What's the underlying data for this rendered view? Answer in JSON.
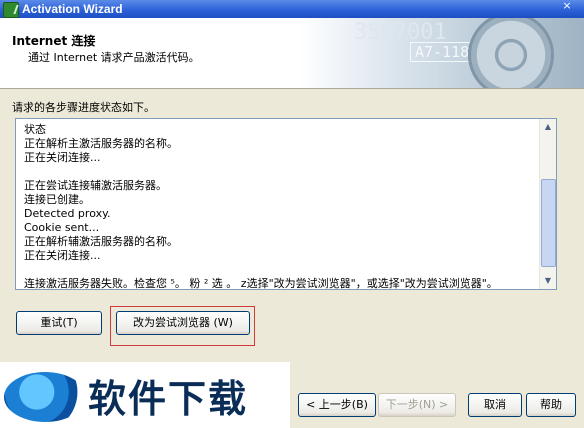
{
  "window": {
    "title": "Activation Wizard",
    "close": "×"
  },
  "header": {
    "title": "Internet 连接",
    "subtitle": "通过 Internet 请求产品激活代码。",
    "banner_number": "3597001",
    "banner_code": "A7-118"
  },
  "intro": "请求的各步骤进度状态如下。",
  "status": {
    "label": "状态",
    "lines": [
      "正在解析主激活服务器的名称。",
      "正在关闭连接...",
      "",
      "正在尝试连接辅激活服务器。",
      "连接已创建。",
      "Detected proxy.",
      "Cookie sent...",
      "正在解析辅激活服务器的名称。",
      "正在关闭连接...",
      "",
      "连接激活服务器失败。检查您 ⁵。 粉 ² 选 。 z选择\"改为尝试浏览器\"，或选择\"改为尝试浏览器\"。"
    ]
  },
  "buttons": {
    "retry": "重试(T)",
    "try_browser": "改为尝试浏览器 (W)",
    "back": "< 上一步(B)",
    "next": "下一步(N) >",
    "cancel": "取消",
    "help": "帮助"
  },
  "watermark": {
    "text": "软件下载"
  }
}
